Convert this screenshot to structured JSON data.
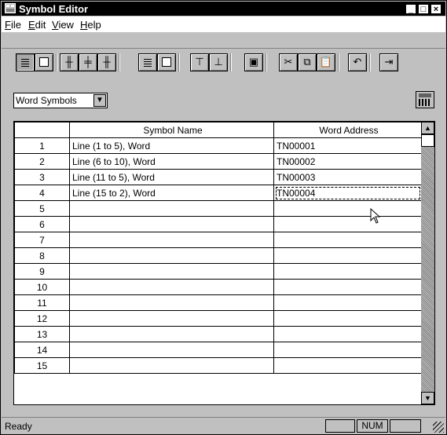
{
  "window": {
    "title": "Symbol Editor"
  },
  "menu": [
    {
      "label": "File",
      "key": "F",
      "rest": "ile"
    },
    {
      "label": "Edit",
      "key": "E",
      "rest": "dit"
    },
    {
      "label": "View",
      "key": "V",
      "rest": "iew"
    },
    {
      "label": "Help",
      "key": "H",
      "rest": "elp"
    }
  ],
  "toolbar": {
    "buttons": [
      "word-view-icon",
      "bit-view-icon",
      "insert-symbol-icon",
      "delete-symbol-icon",
      "edit-symbol-icon",
      "new-table-icon",
      "open-table-icon",
      "import-icon",
      "export-icon",
      "save-icon",
      "cut-icon",
      "copy-icon",
      "paste-icon",
      "undo-icon",
      "exit-icon"
    ]
  },
  "symbol_type": {
    "selected": "Word Symbols"
  },
  "table": {
    "headers": {
      "number": "",
      "symbol_name": "Symbol Name",
      "word_address": "Word Address"
    },
    "rows": [
      {
        "no": "1",
        "name": "Line (1 to 5), Word",
        "addr": "TN00001"
      },
      {
        "no": "2",
        "name": "Line (6 to 10), Word",
        "addr": "TN00002"
      },
      {
        "no": "3",
        "name": "Line (11 to 5), Word",
        "addr": "TN00003"
      },
      {
        "no": "4",
        "name": "Line (15 to 2), Word",
        "addr": "TN00004"
      },
      {
        "no": "5",
        "name": "",
        "addr": ""
      },
      {
        "no": "6",
        "name": "",
        "addr": ""
      },
      {
        "no": "7",
        "name": "",
        "addr": ""
      },
      {
        "no": "8",
        "name": "",
        "addr": ""
      },
      {
        "no": "9",
        "name": "",
        "addr": ""
      },
      {
        "no": "10",
        "name": "",
        "addr": ""
      },
      {
        "no": "11",
        "name": "",
        "addr": ""
      },
      {
        "no": "12",
        "name": "",
        "addr": ""
      },
      {
        "no": "13",
        "name": "",
        "addr": ""
      },
      {
        "no": "14",
        "name": "",
        "addr": ""
      },
      {
        "no": "15",
        "name": "",
        "addr": ""
      }
    ]
  },
  "status": {
    "text": "Ready",
    "num": "NUM"
  }
}
